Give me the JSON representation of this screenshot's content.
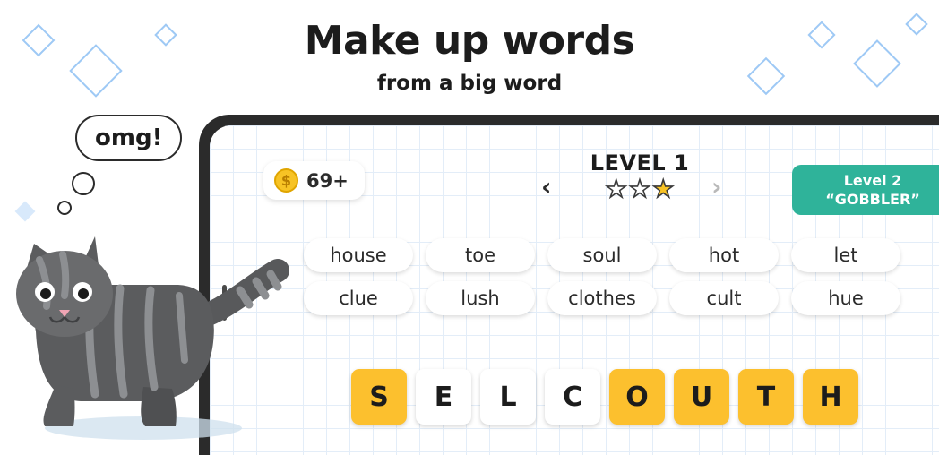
{
  "header": {
    "title": "Make up words",
    "subtitle": "from a big word"
  },
  "cat": {
    "speech_bubble": "omg!"
  },
  "game": {
    "coins": {
      "icon": "coin-icon",
      "value": "69+"
    },
    "level_label": "LEVEL 1",
    "stars": [
      "empty",
      "empty",
      "full"
    ],
    "prev_arrow": "‹",
    "next_arrow": "›",
    "next_level_button": {
      "line1": "Level 2",
      "line2": "“GOBBLER”",
      "color": "#2fb39a"
    },
    "found_words_row1": [
      "house",
      "toe",
      "soul",
      "hot",
      "let"
    ],
    "found_words_row2": [
      "clue",
      "lush",
      "clothes",
      "cult",
      "hue"
    ],
    "letters": [
      {
        "char": "S",
        "state": "gold"
      },
      {
        "char": "E",
        "state": "white"
      },
      {
        "char": "L",
        "state": "white"
      },
      {
        "char": "C",
        "state": "white"
      },
      {
        "char": "O",
        "state": "gold"
      },
      {
        "char": "U",
        "state": "gold"
      },
      {
        "char": "T",
        "state": "gold"
      },
      {
        "char": "H",
        "state": "gold"
      }
    ],
    "accent_gold": "#fcc02e",
    "accent_teal": "#2fb39a"
  }
}
